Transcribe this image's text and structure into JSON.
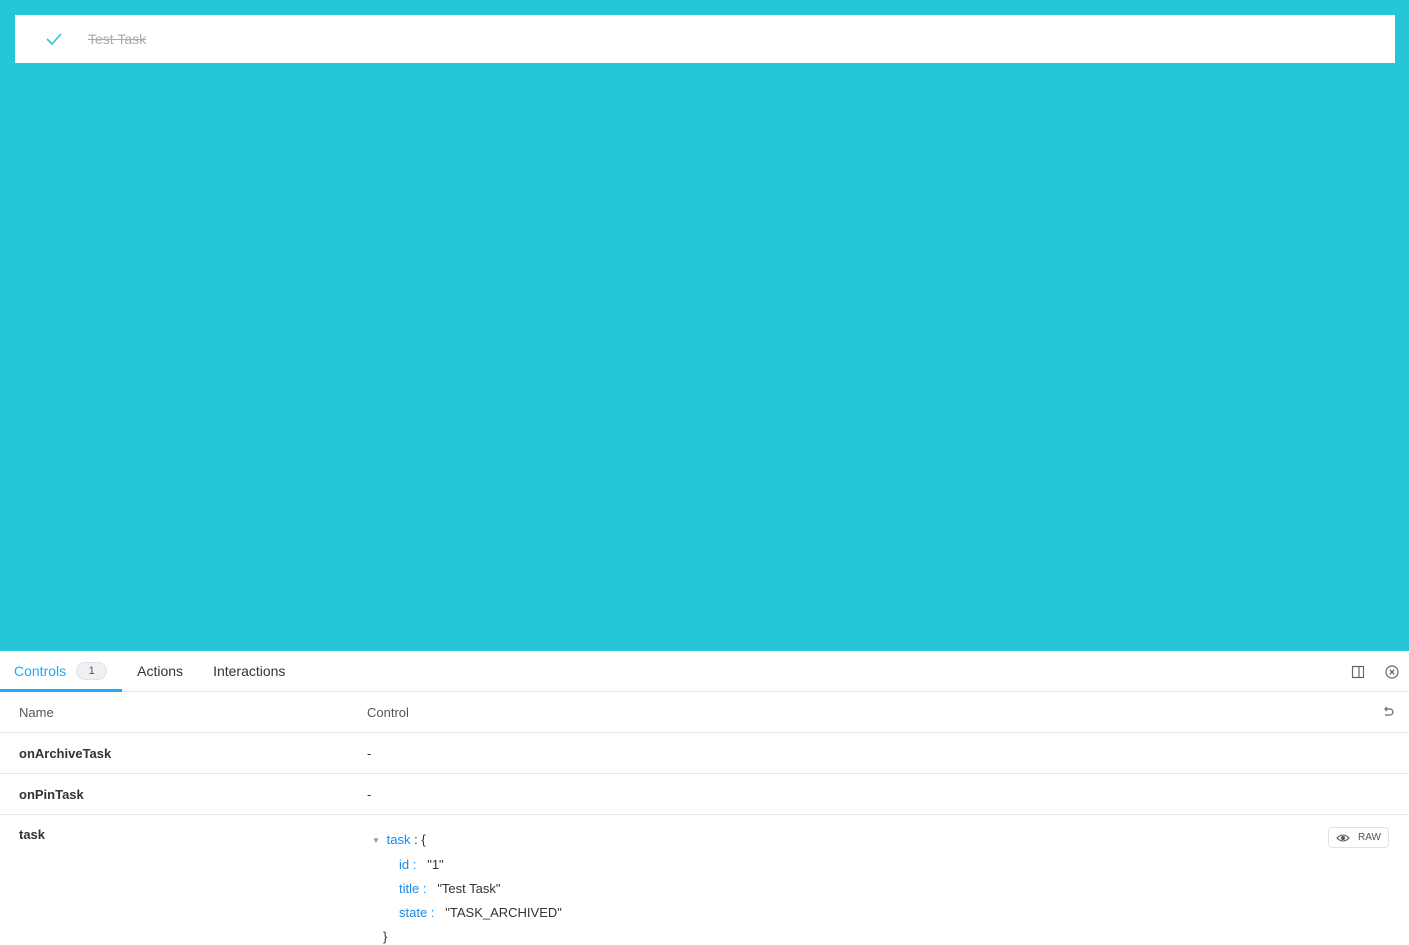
{
  "preview": {
    "task_title": "Test Task",
    "background_color": "#26c6da",
    "check_color": "#26c6da"
  },
  "tabs": [
    {
      "label": "Controls",
      "badge": "1"
    },
    {
      "label": "Actions"
    },
    {
      "label": "Interactions"
    }
  ],
  "accent_color": "#1ea7fd",
  "table": {
    "headers": {
      "name": "Name",
      "control": "Control"
    },
    "rows": [
      {
        "name": "onArchiveTask",
        "control": "-"
      },
      {
        "name": "onPinTask",
        "control": "-"
      },
      {
        "name": "task"
      }
    ]
  },
  "task_json": {
    "root_key": "task",
    "open_brace": "{",
    "close_brace": "}",
    "fields": [
      {
        "key": "id",
        "value": "\"1\""
      },
      {
        "key": "title",
        "value": "\"Test Task\""
      },
      {
        "key": "state",
        "value": "\"TASK_ARCHIVED\""
      }
    ]
  },
  "raw_button": {
    "label": "RAW"
  },
  "icons": {
    "check": "check-icon",
    "layout": "sidebar-layout-icon",
    "close": "close-circle-icon",
    "reset": "undo-icon",
    "eye": "eye-icon",
    "toggle": "caret-down-icon"
  }
}
